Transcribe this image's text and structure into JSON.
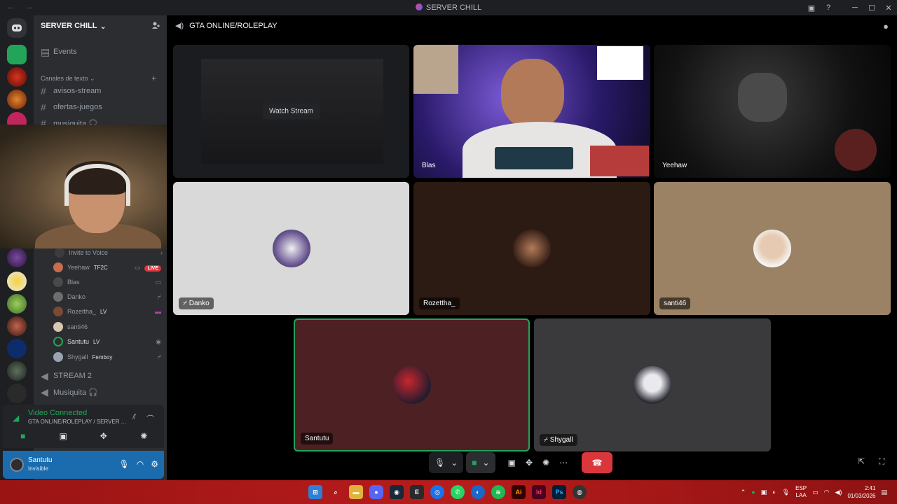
{
  "window": {
    "title": "SERVER CHILL",
    "nav": "← →"
  },
  "sidebar": {
    "server_name": "SERVER CHILL",
    "events_label": "Events",
    "text_category": "Canales de texto",
    "text_channels": [
      "avisos-stream",
      "ofertas-juegos",
      "musiquita 🎧"
    ],
    "invite_label": "Invite to Voice",
    "voice_users": [
      {
        "name": "Yeehaw",
        "tag": "TF2C",
        "live": "LIVE"
      },
      {
        "name": "Blas"
      },
      {
        "name": "Danko"
      },
      {
        "name": "Rozettha_",
        "tag": "LV"
      },
      {
        "name": "santi46"
      },
      {
        "name": "Santutu",
        "tag": "LV"
      },
      {
        "name": "Shygall",
        "tag": "Femboy"
      }
    ],
    "voice_channels": [
      "STREAM 2",
      "Musiquita 🎧"
    ]
  },
  "voice_connected": {
    "status": "Video Connected",
    "channel": "GTA ONLINE/ROLEPLAY / SERVER ..."
  },
  "user_panel": {
    "name": "Santutu",
    "status": "Invisible"
  },
  "main": {
    "channel_title": "GTA ONLINE/ROLEPLAY",
    "watch_stream_label": "Watch Stream",
    "tiles": {
      "blas": "Blas",
      "yeehaw": "Yeehaw",
      "danko": "Danko",
      "rozettha": "Rozettha_",
      "santi": "santi46",
      "santutu": "Santutu",
      "shygall": "Shygall"
    }
  },
  "taskbar": {
    "lang_top": "ESP",
    "lang_bottom": "LAA",
    "time": "2:41",
    "date": "01/03/2026"
  },
  "colors": {
    "accent": "#5865f2",
    "connected_green": "#23a559",
    "live_red": "#da373c",
    "user_panel_blue": "#1a6cae",
    "santutu_tile": "#4d2123",
    "danko_tile": "#d9d9d9",
    "rozettha_tile": "#2c1b13",
    "santi_tile": "#9b8264",
    "shygall_tile": "#3a3a3d"
  }
}
